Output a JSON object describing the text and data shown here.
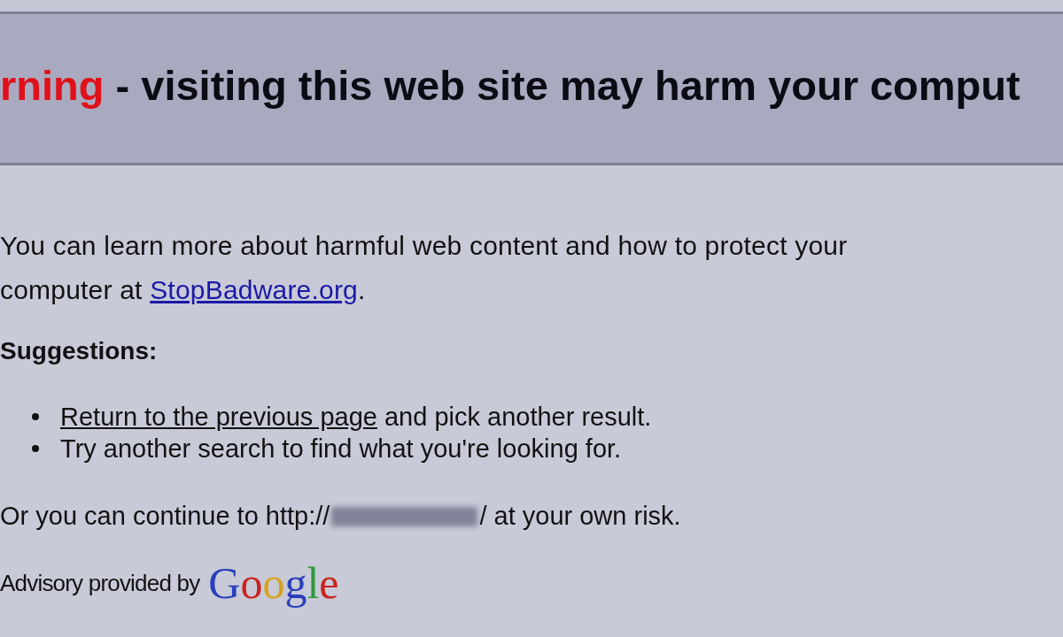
{
  "warning_banner": {
    "heading_highlight": "rning",
    "heading_rest": " - visiting this web site may harm your comput"
  },
  "intro": {
    "text": "You can learn more about harmful web content and how to protect your computer at ",
    "link": "StopBadware.org",
    "after": "."
  },
  "suggestions": {
    "heading": "Suggestions:",
    "items": [
      {
        "link": "Return to the previous page",
        "text": " and pick another result."
      },
      {
        "text": "Try another search to find what you're looking for."
      }
    ]
  },
  "continue": {
    "prefix": "Or you can continue to http://",
    "suffix": "/ at your own risk."
  },
  "advisory": {
    "text": "Advisory provided by",
    "logo": "Google"
  }
}
